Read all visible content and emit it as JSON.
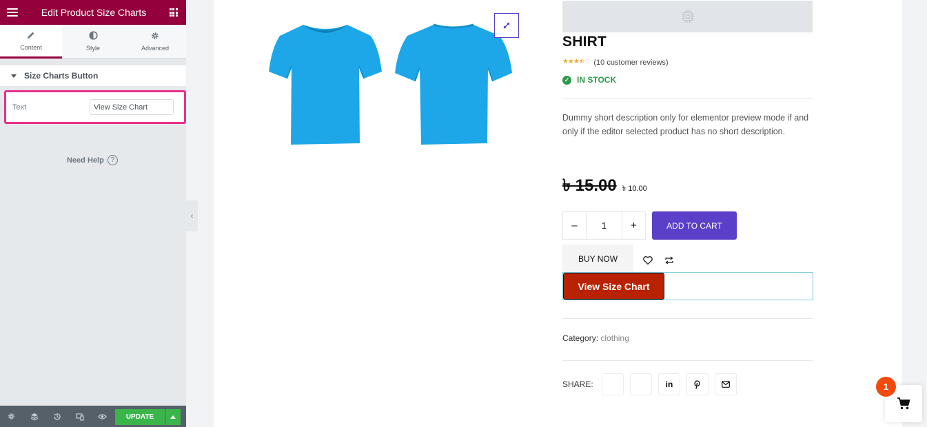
{
  "panel": {
    "title": "Edit Product Size Charts",
    "tabs": [
      {
        "label": "Content",
        "icon": "pencil-icon"
      },
      {
        "label": "Style",
        "icon": "half-circle-icon"
      },
      {
        "label": "Advanced",
        "icon": "gear-icon"
      }
    ],
    "section_title": "Size Charts Button",
    "text_control": {
      "label": "Text",
      "value": "View Size Chart"
    },
    "need_help": "Need Help",
    "footer": {
      "update_label": "UPDATE"
    }
  },
  "product": {
    "title": "SHIRT",
    "reviews_text": "(10 customer reviews)",
    "rating": 3.5,
    "rating_max": 5,
    "stock_text": "IN STOCK",
    "short_description": "Dummy short description only for elementor preview mode if and only if the editor selected product has no short description.",
    "price_old": "৳ 15.00",
    "price_new": "৳ 10.00",
    "quantity": "1",
    "qty_minus": "–",
    "qty_plus": "+",
    "add_to_cart_label": "ADD TO CART",
    "buy_now_label": "BUY NOW",
    "size_chart_label": "View Size Chart",
    "category_label": "Category:",
    "category_value": "clothing",
    "share_label": "SHARE:"
  },
  "cart": {
    "count": "1"
  },
  "colors": {
    "panel_header": "#93003c",
    "highlight": "#e8308a",
    "add_to_cart": "#5b3fc9",
    "size_chart_button": "#b82200",
    "in_stock": "#2c9a4a",
    "update": "#39b54a",
    "cart_badge": "#f04b0a",
    "tshirt": "#1ea7e8"
  }
}
